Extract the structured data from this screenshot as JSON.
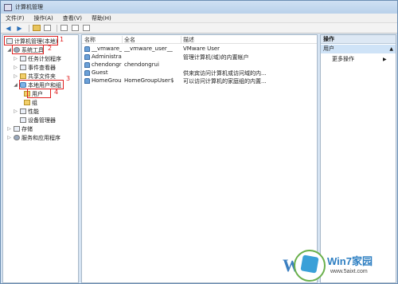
{
  "window": {
    "title": "计算机管理"
  },
  "menubar": {
    "items": [
      "文件(F)",
      "操作(A)",
      "查看(V)",
      "帮助(H)"
    ]
  },
  "tree": {
    "items": [
      {
        "label": "计算机管理(本地)",
        "level": 0,
        "expander": ""
      },
      {
        "label": "系统工具",
        "level": 1,
        "expander": "◢"
      },
      {
        "label": "任务计划程序",
        "level": 2,
        "expander": "▷"
      },
      {
        "label": "事件查看器",
        "level": 2,
        "expander": "▷"
      },
      {
        "label": "共享文件夹",
        "level": 2,
        "expander": "▷"
      },
      {
        "label": "本地用户和组",
        "level": 2,
        "expander": "◢"
      },
      {
        "label": "用户",
        "level": 3,
        "expander": ""
      },
      {
        "label": "组",
        "level": 3,
        "expander": ""
      },
      {
        "label": "性能",
        "level": 2,
        "expander": "▷"
      },
      {
        "label": "设备管理器",
        "level": 2,
        "expander": ""
      },
      {
        "label": "存储",
        "level": 1,
        "expander": "▷"
      },
      {
        "label": "服务和应用程序",
        "level": 1,
        "expander": "▷"
      }
    ],
    "annotations": [
      "1",
      "2",
      "3",
      "4"
    ]
  },
  "list": {
    "columns": [
      "名称",
      "全名",
      "描述"
    ],
    "rows": [
      {
        "name": "__vmware_u...",
        "fullname": "__vmware_user__",
        "desc": "VMware User"
      },
      {
        "name": "Administrat...",
        "fullname": "",
        "desc": "管理计算机(域)的内置帐户"
      },
      {
        "name": "chendongrui",
        "fullname": "chendongrui",
        "desc": ""
      },
      {
        "name": "Guest",
        "fullname": "",
        "desc": "供来宾访问计算机或访问域的内..."
      },
      {
        "name": "HomeGrou...",
        "fullname": "HomeGroupUser$",
        "desc": "可以访问计算机的家庭组的内置..."
      }
    ]
  },
  "actions": {
    "header": "操作",
    "selected": "用户",
    "more": "更多操作"
  },
  "watermark": {
    "brand": "Win7家园",
    "url": "www.5aixt.com",
    "letter": "W"
  }
}
